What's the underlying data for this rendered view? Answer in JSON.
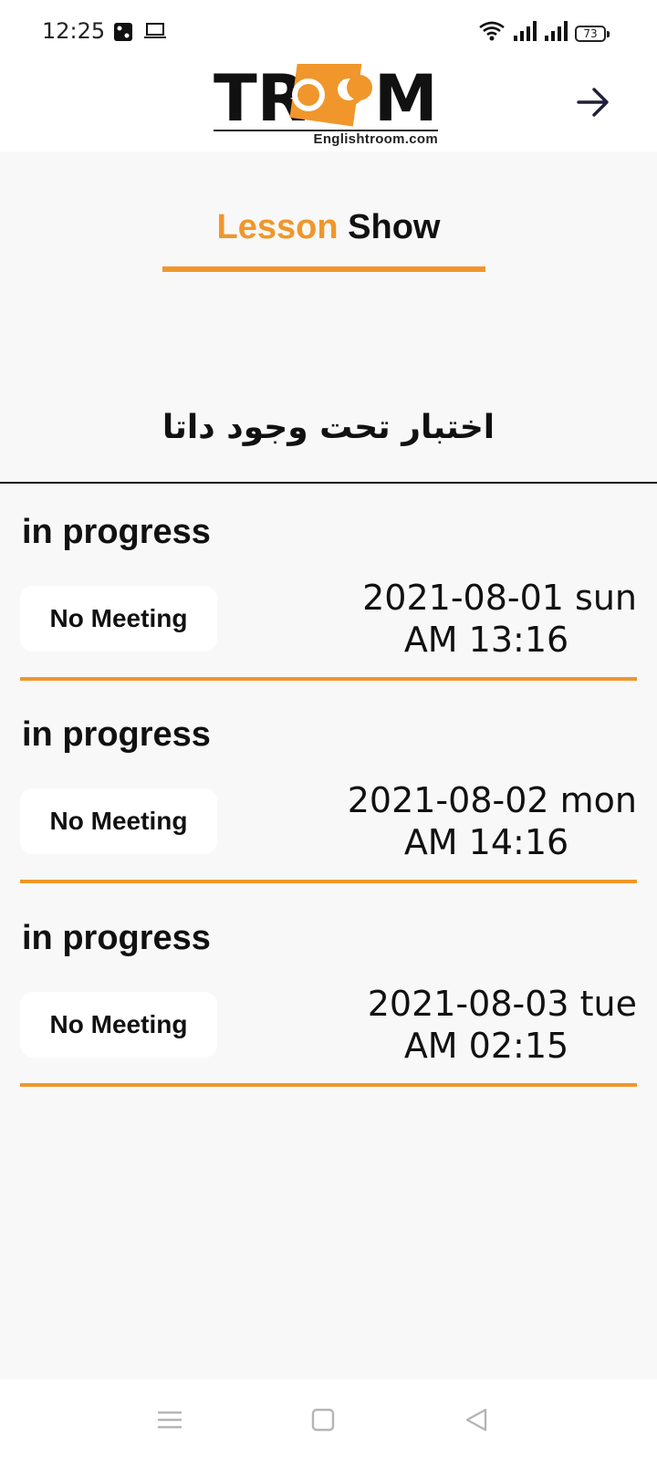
{
  "status_bar": {
    "time": "12:25",
    "battery": "73",
    "icons": [
      "dice-icon",
      "laptop-icon",
      "wifi-icon",
      "signal-icon",
      "signal-icon-2",
      "battery-icon"
    ]
  },
  "header": {
    "logo_text": "TROOM",
    "logo_subtitle": "Englishtroom.com",
    "forward_icon": "arrow-right-icon"
  },
  "page": {
    "title_part1": "Lesson",
    "title_part2": "Show",
    "lesson_name": "اختبار تحت وجود داتا"
  },
  "sessions": [
    {
      "status": "in progress",
      "button": "No Meeting",
      "date": "2021-08-01 sun",
      "time": "AM 13:16"
    },
    {
      "status": "in progress",
      "button": "No Meeting",
      "date": "2021-08-02 mon",
      "time": "AM 14:16"
    },
    {
      "status": "in progress",
      "button": "No Meeting",
      "date": "2021-08-03 tue",
      "time": "AM 02:15"
    }
  ],
  "nav": {
    "icons": [
      "menu-icon",
      "home-icon",
      "back-icon"
    ]
  },
  "colors": {
    "accent": "#f0962b",
    "background": "#f8f8f8"
  }
}
